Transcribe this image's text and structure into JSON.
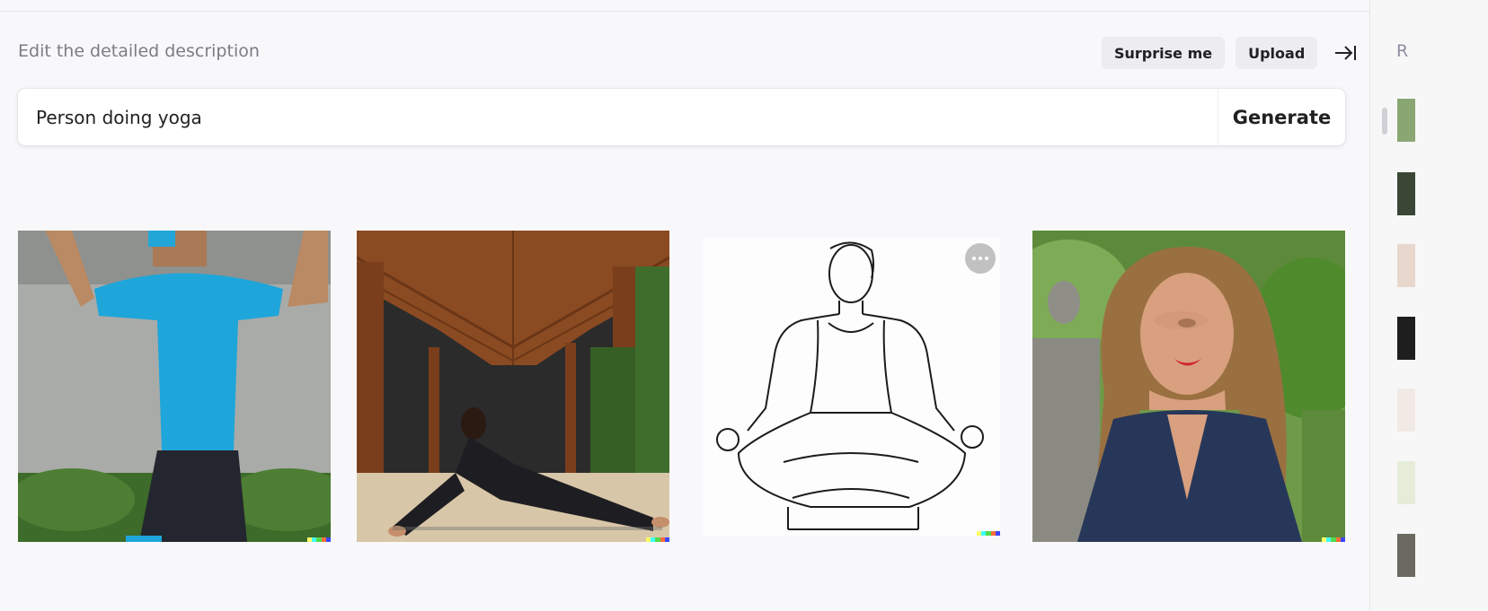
{
  "header": {
    "prompt_label": "Edit the detailed description",
    "surprise_label": "Surprise me",
    "upload_label": "Upload",
    "collapse_icon": "collapse-right-icon"
  },
  "prompt": {
    "value": "Person doing yoga",
    "generate_label": "Generate"
  },
  "results": [
    {
      "name": "result-image-1",
      "subject": "man in blue shirt stretching"
    },
    {
      "name": "result-image-2",
      "subject": "woman doing splits under wooden roof"
    },
    {
      "name": "result-image-3",
      "subject": "line drawing of man meditating"
    },
    {
      "name": "result-image-4",
      "subject": "woman with eyes closed in garden"
    }
  ],
  "history_panel": {
    "label": "R"
  },
  "colors": {
    "accent_watermark": [
      "#ffff66",
      "#42ffff",
      "#51da4c",
      "#ff6e3c",
      "#3c46ff"
    ]
  }
}
